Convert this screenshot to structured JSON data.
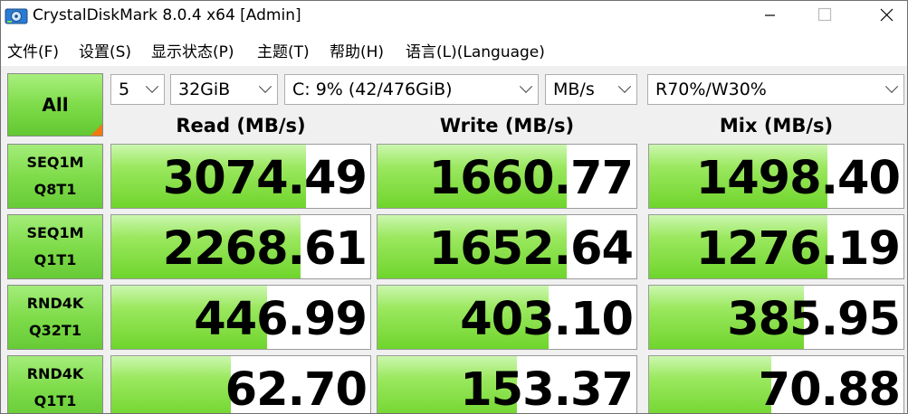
{
  "window": {
    "title": "CrystalDiskMark 8.0.4 x64 [Admin]",
    "minimize_glyph": "—",
    "maximize_glyph": "☐",
    "close_glyph": "✕"
  },
  "menu": [
    "文件(F)",
    "设置(S)",
    "显示状态(P)",
    "主题(T)",
    "帮助(H)",
    "语言(L)(Language)"
  ],
  "controls": {
    "all_label": "All",
    "count": "5",
    "size": "32GiB",
    "drive": "C: 9% (42/476GiB)",
    "unit": "MB/s",
    "mix": "R70%/W30%"
  },
  "columns": [
    "Read (MB/s)",
    "Write (MB/s)",
    "Mix (MB/s)"
  ],
  "tests": [
    {
      "line1": "SEQ1M",
      "line2": "Q8T1",
      "read": "3074.49",
      "write": "1660.77",
      "mix": "1498.40"
    },
    {
      "line1": "SEQ1M",
      "line2": "Q1T1",
      "read": "2268.61",
      "write": "1652.64",
      "mix": "1276.19"
    },
    {
      "line1": "RND4K",
      "line2": "Q32T1",
      "read": "446.99",
      "write": "403.10",
      "mix": "385.95"
    },
    {
      "line1": "RND4K",
      "line2": "Q1T1",
      "read": "62.70",
      "write": "153.37",
      "mix": "70.88"
    }
  ],
  "bar_fill": {
    "read": [
      0.75,
      0.73,
      0.6,
      0.46
    ],
    "write": [
      0.73,
      0.73,
      0.66,
      0.54
    ],
    "mix": [
      0.7,
      0.7,
      0.61,
      0.48
    ]
  },
  "colors": {
    "accent_green": "#7fdc4a",
    "corner_orange": "#f07a10"
  }
}
